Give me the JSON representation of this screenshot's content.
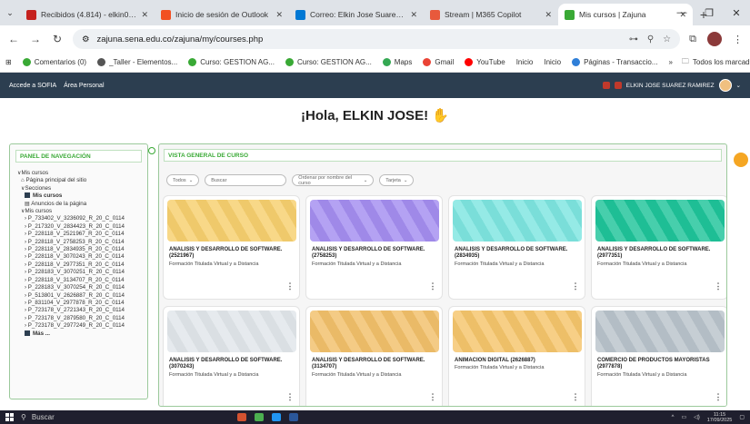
{
  "browser": {
    "tabs": [
      {
        "title": "Recibidos (4.814) - elkin081",
        "color": "#c5221f"
      },
      {
        "title": "Inicio de sesión de Outlook",
        "color": "#f25022"
      },
      {
        "title": "Correo: Elkin Jose Suarez Ra",
        "color": "#0078d4"
      },
      {
        "title": "Stream | M365 Copilot",
        "color": "#e8593c"
      },
      {
        "title": "Mis cursos | Zajuna",
        "color": "#39a935",
        "active": true
      }
    ],
    "url": "zajuna.sena.edu.co/zajuna/my/courses.php",
    "bookmarks": [
      {
        "label": "Comentarios (0)",
        "color": "#39a935"
      },
      {
        "label": "_Taller - Elementos...",
        "color": "#555555"
      },
      {
        "label": "Curso: GESTION AG...",
        "color": "#39a935"
      },
      {
        "label": "Curso: GESTION AG...",
        "color": "#39a935"
      },
      {
        "label": "Maps",
        "color": "#34a853"
      },
      {
        "label": "Gmail",
        "color": "#ea4335"
      },
      {
        "label": "YouTube",
        "color": "#ff0000"
      },
      {
        "label": "Inicio",
        "color": ""
      },
      {
        "label": "Inicio",
        "color": ""
      },
      {
        "label": "Páginas - Transaccio...",
        "color": "#2f7fd8"
      }
    ],
    "bookmarks_overflow": "»",
    "all_bookmarks": "Todos los marcadores"
  },
  "site": {
    "header_links": [
      "Accede a SOFIA",
      "Área Personal"
    ],
    "user_name": "ELKIN JOSE SUAREZ RAMIREZ",
    "greeting": "¡Hola, ELKIN JOSE!",
    "greeting_icon": "waving-hand"
  },
  "sidebar": {
    "title": "PANEL DE NAVEGACIÓN",
    "root": "Mis cursos",
    "home": "Página principal del sitio",
    "sections": "Secciones",
    "my_courses": "Mis cursos",
    "site_notices": "Anuncios de la página",
    "courses_node": "Mis cursos",
    "course_codes": [
      "P_733402_V_3236092_R_20_C_0114",
      "P_217320_V_2834423_R_20_C_0114",
      "P_228118_V_2521967_R_20_C_0114",
      "P_228118_V_2758253_R_20_C_0114",
      "P_228118_V_2834935_R_20_C_0114",
      "P_228118_V_3070243_R_20_C_0114",
      "P_228118_V_2977351_R_20_C_0114",
      "P_228183_V_3070251_R_20_C_0114",
      "P_228118_V_3134707_R_20_C_0114",
      "P_228183_V_3070254_R_20_C_0114",
      "P_513801_V_2626887_R_20_C_0114",
      "P_831104_V_2977878_R_20_C_0114",
      "P_723178_V_2721343_R_20_C_0114",
      "P_723178_V_2879580_R_20_C_0114",
      "P_723178_V_2977249_R_20_C_0114"
    ],
    "more": "Más ..."
  },
  "overview": {
    "title": "VISTA GENERAL DE CURSO",
    "filter_all": "Todos",
    "search_placeholder": "Buscar",
    "sort_label": "Ordenar por nombre del curso",
    "view_label": "Tarjeta",
    "courses": [
      {
        "name": "ANALISIS Y DESARROLLO DE SOFTWARE.",
        "code": "(2521967)",
        "sub": "Formación Titulada Virtual y a Distancia",
        "color": "#f7cf6e"
      },
      {
        "name": "ANALISIS Y DESARROLLO DE SOFTWARE.",
        "code": "(2758253)",
        "sub": "Formación Titulada Virtual y a Distancia",
        "color": "#a48df0"
      },
      {
        "name": "ANALISIS Y DESARROLLO DE SOFTWARE.",
        "code": "(2834935)",
        "sub": "Formación Titulada Virtual y a Distancia",
        "color": "#7ee5e0"
      },
      {
        "name": "ANALISIS Y DESARROLLO DE SOFTWARE.",
        "code": "(2977351)",
        "sub": "Formación Titulada Virtual y a Distancia",
        "color": "#1fc49a"
      },
      {
        "name": "ANALISIS Y DESARROLLO DE SOFTWARE.",
        "code": "(3070243)",
        "sub": "Formación Titulada Virtual y a Distancia",
        "color": "#e1e6ea"
      },
      {
        "name": "ANALISIS Y DESARROLLO DE SOFTWARE.",
        "code": "(3134707)",
        "sub": "Formación Titulada Virtual y a Distancia",
        "color": "#f2c06a"
      },
      {
        "name": "ANIMACION DIGITAL (2626887)",
        "code": "",
        "sub": "Formación Titulada Virtual y a Distancia",
        "color": "#f5c56b"
      },
      {
        "name": "COMERCIO DE PRODUCTOS MAYORISTAS",
        "code": "(2977878)",
        "sub": "Formación Titulada Virtual y a Distancia",
        "color": "#b9c3cb"
      }
    ]
  },
  "taskbar": {
    "search": "Buscar",
    "time": "11:15",
    "date": "17/09/2025"
  }
}
